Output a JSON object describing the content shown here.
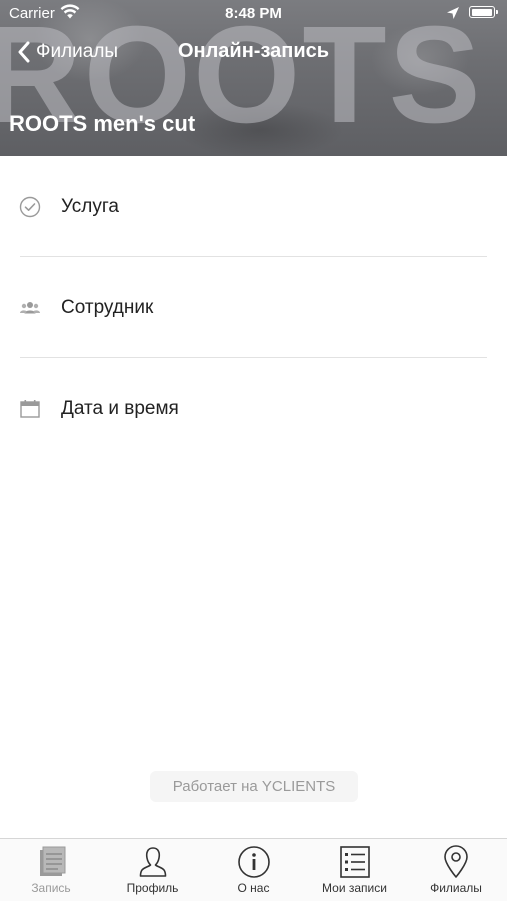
{
  "status_bar": {
    "carrier": "Carrier",
    "time": "8:48 PM"
  },
  "header": {
    "back_label": "Филиалы",
    "title": "Онлайн-запись",
    "salon_name": "ROOTS men's cut",
    "background_word": "ROOTS"
  },
  "booking_steps": [
    {
      "label": "Услуга",
      "icon": "check-circle-icon"
    },
    {
      "label": "Сотрудник",
      "icon": "people-icon"
    },
    {
      "label": "Дата и время",
      "icon": "calendar-icon"
    }
  ],
  "powered_by": "Работает на YCLIENTS",
  "tabbar": {
    "active_index": 0,
    "items": [
      {
        "label": "Запись",
        "icon": "document-icon"
      },
      {
        "label": "Профиль",
        "icon": "person-icon"
      },
      {
        "label": "О нас",
        "icon": "info-icon"
      },
      {
        "label": "Мои записи",
        "icon": "list-icon"
      },
      {
        "label": "Филиалы",
        "icon": "location-pin-icon"
      }
    ]
  },
  "colors": {
    "tab_active": "#9a9a9a",
    "tab_inactive": "#333333",
    "separator": "#e2e2e2"
  }
}
